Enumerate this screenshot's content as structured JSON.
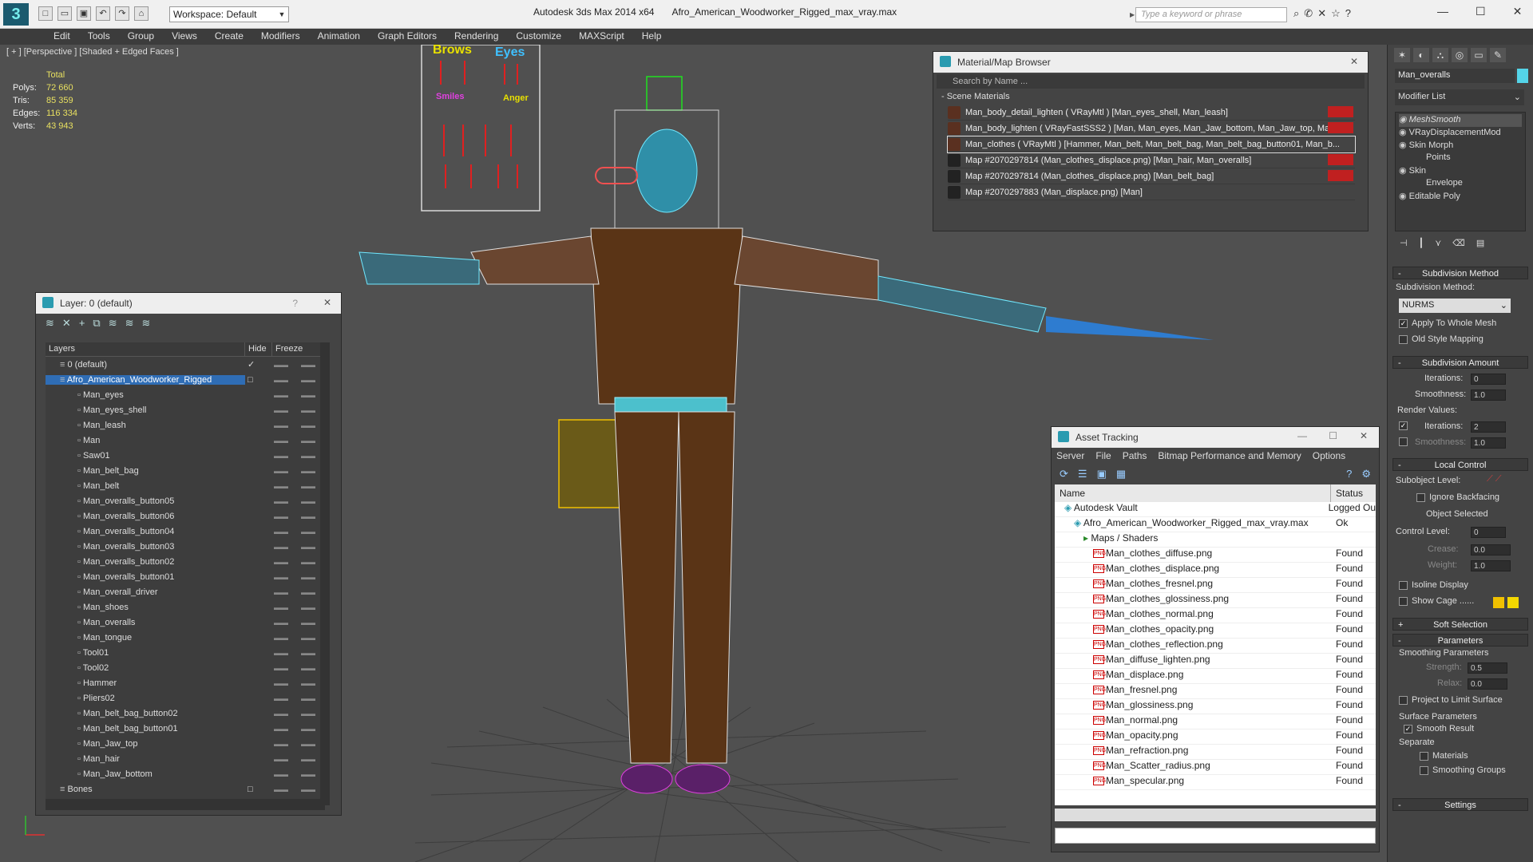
{
  "app": {
    "workspace": "Workspace: Default",
    "product": "Autodesk 3ds Max  2014 x64",
    "file": "Afro_American_Woodworker_Rigged_max_vray.max",
    "search_placeholder": "Type a keyword or phrase",
    "quick_access": [
      "new-icon",
      "open-icon",
      "save-icon",
      "undo-icon",
      "redo-icon",
      "project-icon"
    ]
  },
  "menu": [
    "Edit",
    "Tools",
    "Group",
    "Views",
    "Create",
    "Modifiers",
    "Animation",
    "Graph Editors",
    "Rendering",
    "Customize",
    "MAXScript",
    "Help"
  ],
  "viewport": {
    "label": "[ + ] [Perspective ] [Shaded + Edged Faces ]",
    "stats_title": "Total",
    "stats": [
      {
        "k": "Polys:",
        "v": "72 660"
      },
      {
        "k": "Tris:",
        "v": "85 359"
      },
      {
        "k": "Edges:",
        "v": "116 334"
      },
      {
        "k": "Verts:",
        "v": "43 943"
      }
    ],
    "facial_labels": [
      "Brows",
      "Eyes",
      "Smiles",
      "Anger"
    ]
  },
  "layer_panel": {
    "title": "Layer: 0 (default)",
    "help": "?",
    "col_layers": "Layers",
    "col_hide": "Hide",
    "col_freeze": "Freeze",
    "rows": [
      {
        "name": "0 (default)",
        "indent": 1,
        "check": "✓"
      },
      {
        "name": "Afro_American_Woodworker_Rigged",
        "indent": 1,
        "selected": true,
        "check": "□"
      },
      {
        "name": "Man_eyes",
        "indent": 2
      },
      {
        "name": "Man_eyes_shell",
        "indent": 2
      },
      {
        "name": "Man_leash",
        "indent": 2
      },
      {
        "name": "Man",
        "indent": 2
      },
      {
        "name": "Saw01",
        "indent": 2
      },
      {
        "name": "Man_belt_bag",
        "indent": 2
      },
      {
        "name": "Man_belt",
        "indent": 2
      },
      {
        "name": "Man_overalls_button05",
        "indent": 2
      },
      {
        "name": "Man_overalls_button06",
        "indent": 2
      },
      {
        "name": "Man_overalls_button04",
        "indent": 2
      },
      {
        "name": "Man_overalls_button03",
        "indent": 2
      },
      {
        "name": "Man_overalls_button02",
        "indent": 2
      },
      {
        "name": "Man_overalls_button01",
        "indent": 2
      },
      {
        "name": "Man_overall_driver",
        "indent": 2
      },
      {
        "name": "Man_shoes",
        "indent": 2
      },
      {
        "name": "Man_overalls",
        "indent": 2
      },
      {
        "name": "Man_tongue",
        "indent": 2
      },
      {
        "name": "Tool01",
        "indent": 2
      },
      {
        "name": "Tool02",
        "indent": 2
      },
      {
        "name": "Hammer",
        "indent": 2
      },
      {
        "name": "Pliers02",
        "indent": 2
      },
      {
        "name": "Man_belt_bag_button02",
        "indent": 2
      },
      {
        "name": "Man_belt_bag_button01",
        "indent": 2
      },
      {
        "name": "Man_Jaw_top",
        "indent": 2
      },
      {
        "name": "Man_hair",
        "indent": 2
      },
      {
        "name": "Man_Jaw_bottom",
        "indent": 2
      },
      {
        "name": "Bones",
        "indent": 1,
        "check": "□"
      }
    ]
  },
  "material_browser": {
    "title": "Material/Map Browser",
    "search_placeholder": "Search by Name ...",
    "section": "- Scene Materials",
    "rows": [
      {
        "text": "Man_body_detail_lighten  ( VRayMtl ) [Man_eyes_shell, Man_leash]",
        "type": "mtl",
        "red": true
      },
      {
        "text": "Man_body_lighten  ( VRayFastSSS2 ) [Man, Man_eyes, Man_Jaw_bottom, Man_Jaw_top, Man...",
        "type": "mtl",
        "red": true
      },
      {
        "text": "Man_clothes  ( VRayMtl ) [Hammer, Man_belt, Man_belt_bag, Man_belt_bag_button01, Man_b...",
        "type": "mtl",
        "red": false,
        "hl": true
      },
      {
        "text": "Map #2070297814 (Man_clothes_displace.png) [Man_hair, Man_overalls]",
        "type": "map",
        "red": true
      },
      {
        "text": "Map #2070297814 (Man_clothes_displace.png) [Man_belt_bag]",
        "type": "map",
        "red": true
      },
      {
        "text": "Map #2070297883 (Man_displace.png) [Man]",
        "type": "map",
        "red": false
      }
    ]
  },
  "asset_tracking": {
    "title": "Asset Tracking",
    "menu": [
      "Server",
      "File",
      "Paths",
      "Bitmap Performance and Memory",
      "Options"
    ],
    "col_name": "Name",
    "col_status": "Status",
    "rows": [
      {
        "name": "Autodesk Vault",
        "status": "Logged Ou",
        "indent": 1,
        "kind": "vault"
      },
      {
        "name": "Afro_American_Woodworker_Rigged_max_vray.max",
        "status": "Ok",
        "indent": 2,
        "kind": "max"
      },
      {
        "name": "Maps / Shaders",
        "status": "",
        "indent": 3,
        "kind": "folder"
      },
      {
        "name": "Man_clothes_diffuse.png",
        "status": "Found",
        "indent": 4,
        "kind": "png"
      },
      {
        "name": "Man_clothes_displace.png",
        "status": "Found",
        "indent": 4,
        "kind": "png"
      },
      {
        "name": "Man_clothes_fresnel.png",
        "status": "Found",
        "indent": 4,
        "kind": "png"
      },
      {
        "name": "Man_clothes_glossiness.png",
        "status": "Found",
        "indent": 4,
        "kind": "png"
      },
      {
        "name": "Man_clothes_normal.png",
        "status": "Found",
        "indent": 4,
        "kind": "png"
      },
      {
        "name": "Man_clothes_opacity.png",
        "status": "Found",
        "indent": 4,
        "kind": "png"
      },
      {
        "name": "Man_clothes_reflection.png",
        "status": "Found",
        "indent": 4,
        "kind": "png"
      },
      {
        "name": "Man_diffuse_lighten.png",
        "status": "Found",
        "indent": 4,
        "kind": "png"
      },
      {
        "name": "Man_displace.png",
        "status": "Found",
        "indent": 4,
        "kind": "png"
      },
      {
        "name": "Man_fresnel.png",
        "status": "Found",
        "indent": 4,
        "kind": "png"
      },
      {
        "name": "Man_glossiness.png",
        "status": "Found",
        "indent": 4,
        "kind": "png"
      },
      {
        "name": "Man_normal.png",
        "status": "Found",
        "indent": 4,
        "kind": "png"
      },
      {
        "name": "Man_opacity.png",
        "status": "Found",
        "indent": 4,
        "kind": "png"
      },
      {
        "name": "Man_refraction.png",
        "status": "Found",
        "indent": 4,
        "kind": "png"
      },
      {
        "name": "Man_Scatter_radius.png",
        "status": "Found",
        "indent": 4,
        "kind": "png"
      },
      {
        "name": "Man_specular.png",
        "status": "Found",
        "indent": 4,
        "kind": "png"
      }
    ],
    "png_badge": "PNG"
  },
  "command_panel": {
    "object_name": "Man_overalls",
    "object_color": "#54d4e8",
    "modifier_list": "Modifier List",
    "stack": [
      {
        "name": "MeshSmooth",
        "style": "italic"
      },
      {
        "name": "VRayDisplacementMod",
        "style": "normal"
      },
      {
        "name": "Skin Morph",
        "style": "normal"
      },
      {
        "name": "Points",
        "style": "sub"
      },
      {
        "name": "Skin",
        "style": "normal"
      },
      {
        "name": "Envelope",
        "style": "sub"
      },
      {
        "name": "Editable Poly",
        "style": "normal"
      }
    ],
    "subdivision_method": {
      "header": "Subdivision Method",
      "label": "Subdivision Method:",
      "value": "NURMS",
      "apply_whole": "Apply To Whole Mesh",
      "old_style": "Old Style Mapping"
    },
    "subdivision_amount": {
      "header": "Subdivision Amount",
      "iterations_label": "Iterations:",
      "iterations": "0",
      "smoothness_label": "Smoothness:",
      "smoothness": "1.0",
      "render_values": "Render Values:",
      "r_iterations_label": "Iterations:",
      "r_iterations": "2",
      "r_smoothness_label": "Smoothness:",
      "r_smoothness": "1.0"
    },
    "local_control": {
      "header": "Local Control",
      "sublevel": "Subobject Level:",
      "ignore_backfacing": "Ignore Backfacing",
      "object_selected": "Object Selected",
      "control_level_label": "Control Level:",
      "control_level": "0",
      "crease_label": "Crease:",
      "crease": "0.0",
      "weight_label": "Weight:",
      "weight": "1.0",
      "isoline": "Isoline Display",
      "show_cage": "Show Cage ......",
      "cage_colors": [
        "#f0c000",
        "#f4d800"
      ]
    },
    "soft_selection": "Soft Selection",
    "parameters": {
      "header": "Parameters",
      "smoothing_params": "Smoothing Parameters",
      "strength_label": "Strength:",
      "strength": "0.5",
      "relax_label": "Relax:",
      "relax": "0.0",
      "project": "Project to Limit Surface",
      "surface_params": "Surface Parameters",
      "smooth_result": "Smooth Result",
      "separate": "Separate",
      "materials": "Materials",
      "smoothing_groups": "Smoothing Groups"
    },
    "settings": "Settings"
  }
}
